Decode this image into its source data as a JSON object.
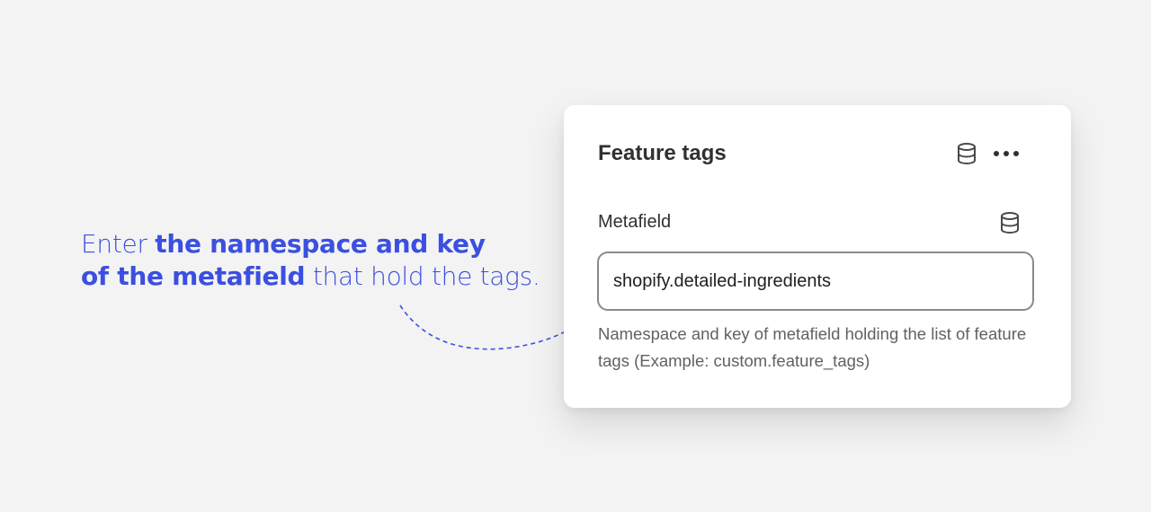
{
  "callout": {
    "line1_normal": "Enter ",
    "line1_bold": "the namespace and key",
    "line2_bold": "of the metafield",
    "line2_normal": " that hold the tags."
  },
  "card": {
    "title": "Feature tags",
    "title_icons": [
      "database-icon",
      "more-options-icon"
    ],
    "field": {
      "label": "Metafield",
      "label_icon": "database-icon",
      "value": "shopify.detailed-ingredients",
      "help_text": "Namespace and key of metafield holding the list of feature tags (Example: custom.feature_tags)"
    }
  },
  "colors": {
    "accent": "#3b4fe0",
    "background": "#f3f3f3",
    "card": "#ffffff",
    "text": "#303030",
    "help_text": "#616161",
    "input_border": "#8a8a8a"
  }
}
